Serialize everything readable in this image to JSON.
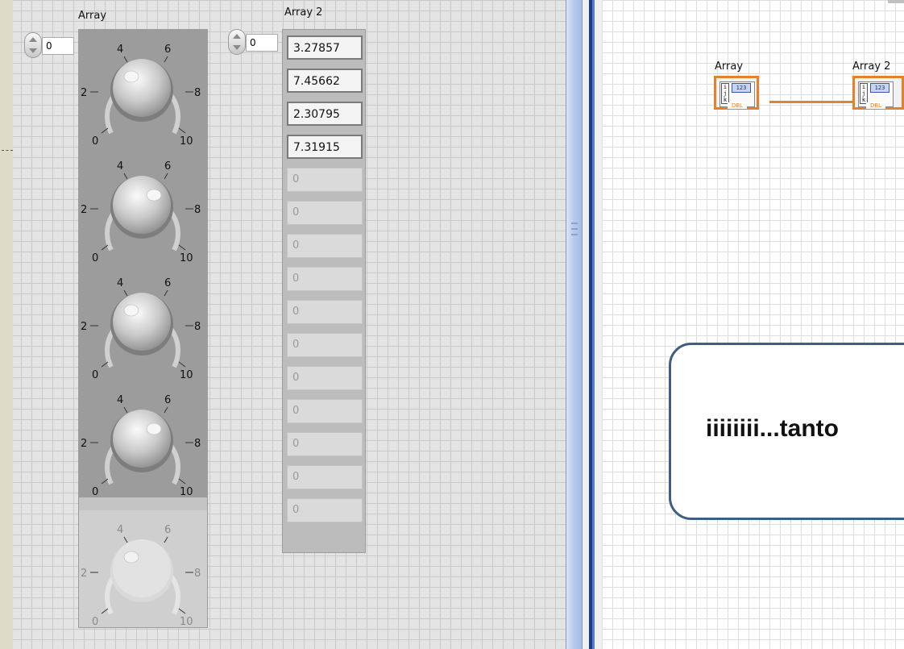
{
  "front_panel": {
    "array_label": "Array",
    "array2_label": "Array 2",
    "array_index": "0",
    "array2_index": "0",
    "knob_scale": [
      "0",
      "2",
      "4",
      "6",
      "8",
      "10"
    ],
    "knob_count": 5,
    "active_knobs": 4,
    "array2_values": [
      "3.27857",
      "7.45662",
      "2.30795",
      "7.31915",
      "0",
      "0",
      "0",
      "0",
      "0",
      "0",
      "0",
      "0",
      "0",
      "0",
      "0"
    ],
    "active_values": 4
  },
  "block_diagram": {
    "array_label": "Array",
    "array2_label": "Array 2",
    "terminal_index_letters": "i j k",
    "terminal_type": "123",
    "terminal_dtype": "DBL",
    "wire_color": "#e2822a"
  },
  "callout": {
    "text": "iiiiiiii...tanto"
  }
}
